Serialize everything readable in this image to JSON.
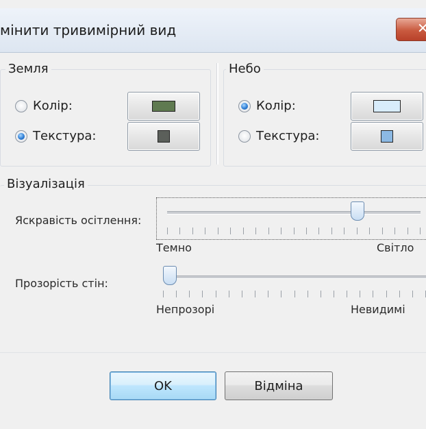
{
  "window": {
    "title": "мінити тривимірний вид"
  },
  "ground": {
    "label": "Земля",
    "color_label": "Колір:",
    "texture_label": "Текстура:",
    "selected": "texture",
    "color_swatch": "#5f7a50",
    "texture_swatch": "#5b5f5a"
  },
  "sky": {
    "label": "Небо",
    "color_label": "Колір:",
    "texture_label": "Текстура:",
    "selected": "color",
    "color_swatch": "#d8ecfb",
    "texture_swatch": "#8cb9e3"
  },
  "visualization": {
    "label": "Візуалізація",
    "brightness": {
      "label": "Яскравість осітлення:",
      "min_label": "Темно",
      "max_label": "Світло",
      "value": 0.76
    },
    "wall_transparency": {
      "label": "Прозорість стін:",
      "min_label": "Непрозорі",
      "max_label": "Невидимі",
      "value": 0.0
    }
  },
  "buttons": {
    "ok": "OK",
    "cancel": "Відміна"
  }
}
